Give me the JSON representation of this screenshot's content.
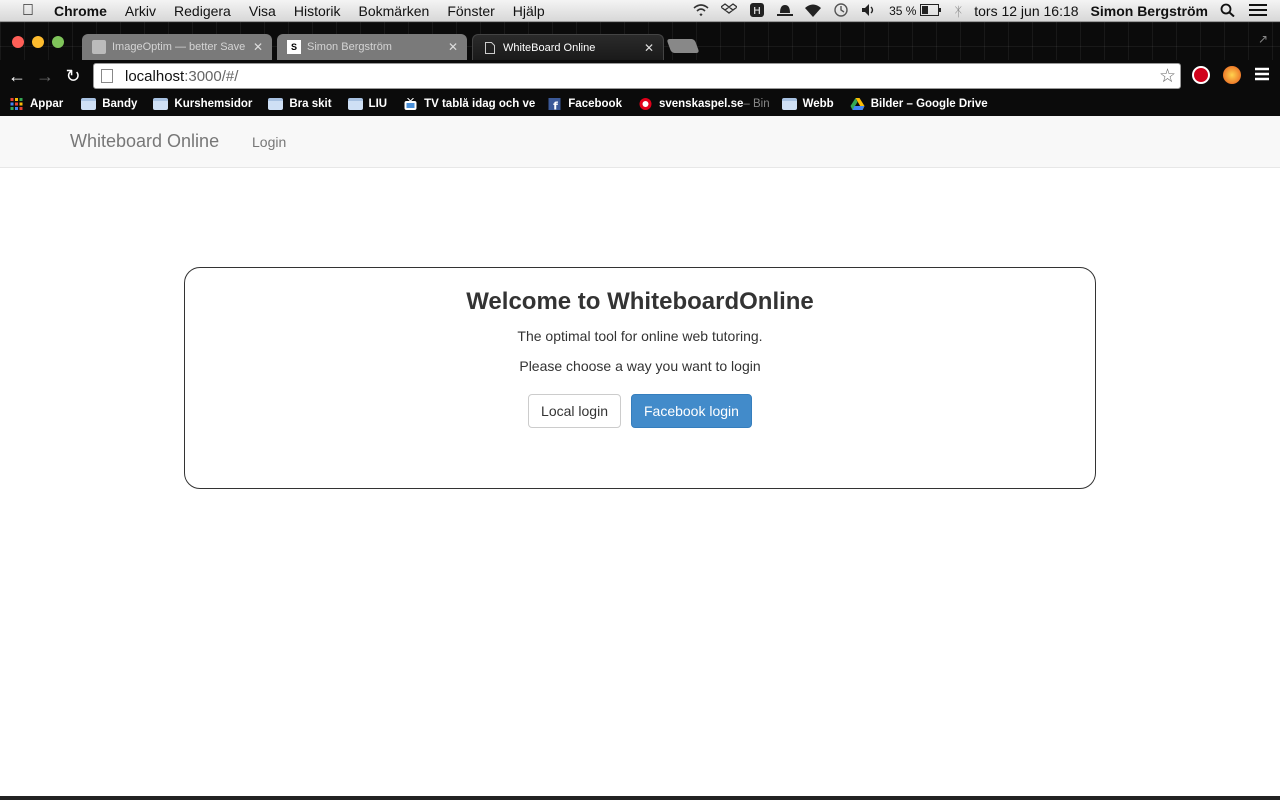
{
  "menubar": {
    "app": "Chrome",
    "items": [
      "Arkiv",
      "Redigera",
      "Visa",
      "Historik",
      "Bokmärken",
      "Fönster",
      "Hjälp"
    ],
    "battery": "35 %",
    "clock": "tors 12 jun  16:18",
    "user": "Simon Bergström"
  },
  "tabs": [
    {
      "title": "ImageOptim — better Save",
      "active": false
    },
    {
      "title": "Simon Bergström",
      "favicon_text": "S",
      "active": false
    },
    {
      "title": "WhiteBoard Online",
      "active": true
    }
  ],
  "address": {
    "host": "localhost",
    "path": ":3000/#/"
  },
  "bookmarks": [
    {
      "label": "Appar",
      "icon": "apps-grid-icon"
    },
    {
      "label": "Bandy",
      "icon": "folder-icon"
    },
    {
      "label": "Kurshemsidor",
      "icon": "folder-icon"
    },
    {
      "label": "Bra skit",
      "icon": "folder-icon"
    },
    {
      "label": "LIU",
      "icon": "folder-icon"
    },
    {
      "label": "TV tablå idag och ve",
      "icon": "tv-icon"
    },
    {
      "label": "Facebook",
      "icon": "facebook-icon"
    },
    {
      "label": "svenskaspel.se",
      "suffix": " – Bin",
      "icon": "svenskaspel-icon"
    },
    {
      "label": "Webb",
      "icon": "folder-icon"
    },
    {
      "label": "Bilder – Google Drive",
      "icon": "google-drive-icon"
    }
  ],
  "app": {
    "brand": "Whiteboard Online",
    "nav_login": "Login",
    "welcome_title": "Welcome to WhiteboardOnline",
    "tagline": "The optimal tool for online web tutoring.",
    "instruction": "Please choose a way you want to login",
    "local_login": "Local login",
    "facebook_login": "Facebook login"
  },
  "colors": {
    "primary_button": "#428bca",
    "navbar_bg": "#f8f8f8"
  }
}
